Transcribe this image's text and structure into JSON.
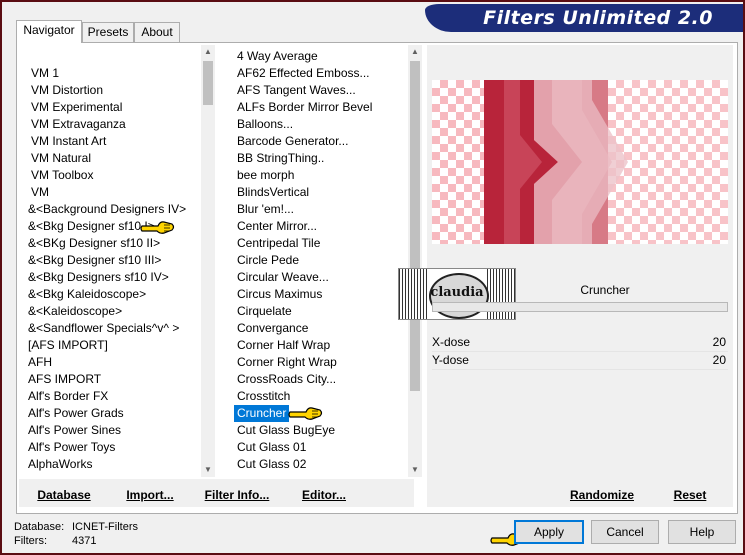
{
  "window": {
    "title": "Filters Unlimited 2.0"
  },
  "tabs": [
    "Navigator",
    "Presets",
    "About"
  ],
  "categories": [
    "VM 1",
    "VM Distortion",
    "VM Experimental",
    "VM Extravaganza",
    "VM Instant Art",
    "VM Natural",
    "VM Toolbox",
    "VM",
    "&<Background Designers IV>",
    "&<Bkg Designer sf10 I>",
    "&<BKg Designer sf10 II>",
    "&<Bkg Designer sf10 III>",
    "&<Bkg Designers sf10 IV>",
    "&<Bkg Kaleidoscope>",
    "&<Kaleidoscope>",
    "&<Sandflower Specials^v^ >",
    "[AFS IMPORT]",
    "AFH",
    "AFS IMPORT",
    "Alf's Border FX",
    "Alf's Power Grads",
    "Alf's Power Sines",
    "Alf's Power Toys",
    "AlphaWorks"
  ],
  "filters": [
    "4 Way Average",
    "AF62 Effected Emboss...",
    "AFS Tangent Waves...",
    "ALFs Border Mirror Bevel",
    "Balloons...",
    "Barcode Generator...",
    "BB StringThing..",
    "bee morph",
    "BlindsVertical",
    "Blur 'em!...",
    "Center Mirror...",
    "Centripedal Tile",
    "Circle Pede",
    "Circular Weave...",
    "Circus Maximus",
    "Cirquelate",
    "Convergance",
    "Corner Half Wrap",
    "Corner Right Wrap",
    "CrossRoads City...",
    "Crosstitch",
    "Cruncher",
    "Cut Glass  BugEye",
    "Cut Glass 01",
    "Cut Glass 02"
  ],
  "selected_filter": "Cruncher",
  "filter_name": "Cruncher",
  "params": [
    {
      "label": "X-dose",
      "value": "20"
    },
    {
      "label": "Y-dose",
      "value": "20"
    }
  ],
  "watermark": "claudia",
  "buttons": {
    "database": "Database",
    "import": "Import...",
    "filter_info": "Filter Info...",
    "editor": "Editor...",
    "randomize": "Randomize",
    "reset": "Reset",
    "apply": "Apply",
    "cancel": "Cancel",
    "help": "Help"
  },
  "status": {
    "database_label": "Database:",
    "database_value": "ICNET-Filters",
    "filters_label": "Filters:",
    "filters_value": "4371"
  },
  "colors": {
    "accent": "#0078d7",
    "banner": "#1c2d7a",
    "frame": "#5a0d12"
  }
}
